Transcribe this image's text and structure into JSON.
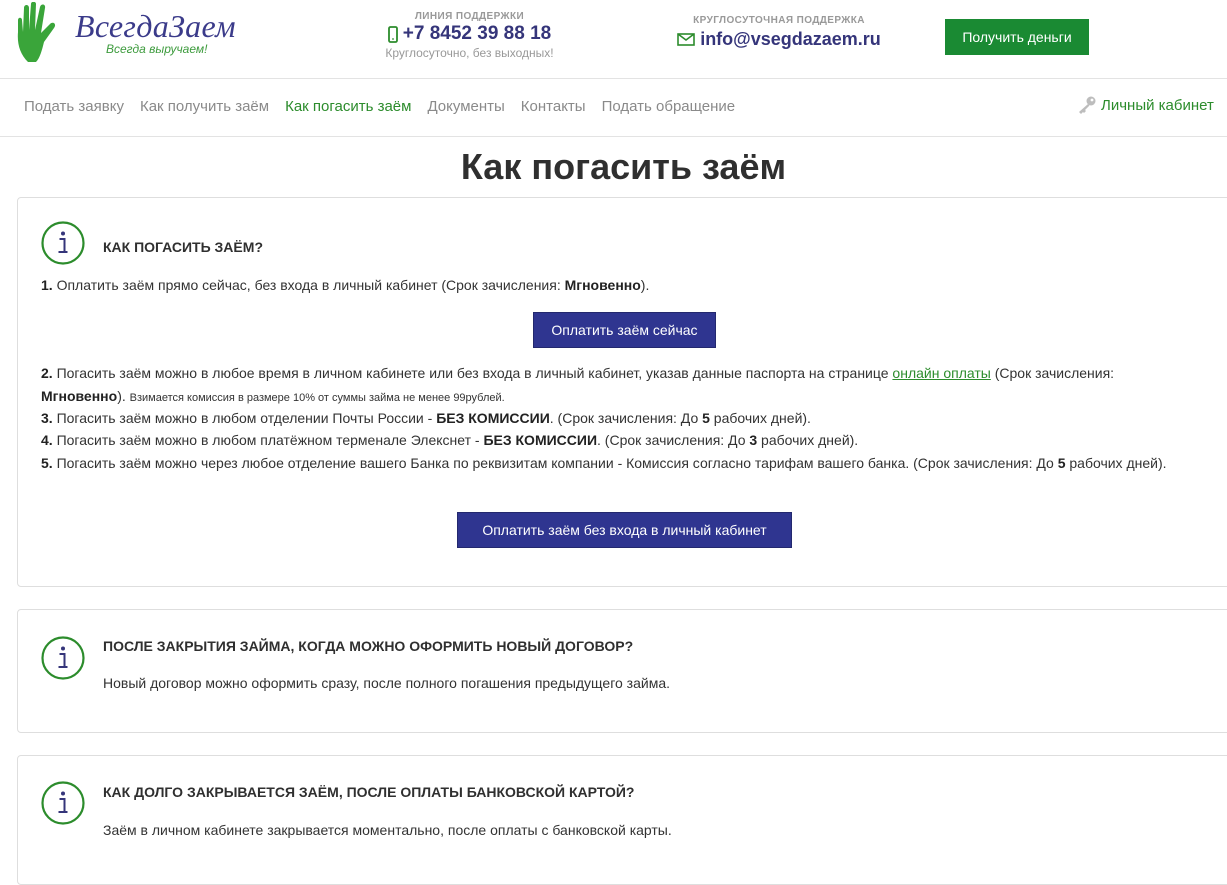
{
  "header": {
    "logo": {
      "name": "ВсегдаЗаем",
      "tagline": "Всегда выручаем!"
    },
    "support_line": {
      "caption": "ЛИНИЯ ПОДДЕРЖКИ",
      "phone": "+7 8452 39 88 18",
      "note": "Круглосуточно, без выходных!"
    },
    "round_the_clock": {
      "caption": "КРУГЛОСУТОЧНАЯ ПОДДЕРЖКА",
      "email": "info@vsegdazaem.ru"
    },
    "cta_label": "Получить деньги"
  },
  "nav": {
    "items": [
      {
        "label": "Подать заявку",
        "active": false
      },
      {
        "label": "Как получить заём",
        "active": false
      },
      {
        "label": "Как погасить заём",
        "active": true
      },
      {
        "label": "Документы",
        "active": false
      },
      {
        "label": "Контакты",
        "active": false
      },
      {
        "label": "Подать обращение",
        "active": false
      }
    ],
    "cabinet_label": "Личный кабинет"
  },
  "page": {
    "title": "Как погасить заём"
  },
  "cards": [
    {
      "heading": "КАК ПОГАСИТЬ ЗАЁМ?",
      "step1": {
        "num": "1.",
        "text": "Оплатить заём прямо сейчас, без входа в личный кабинет (Срок зачисления: ",
        "bold": "Мгновенно",
        "end": ")."
      },
      "pay_now_label": "Оплатить заём сейчас",
      "step2": {
        "num": "2.",
        "text": "Погасить заём можно в любое время в личном кабинете или без входа в личный кабинет, указав данные паспорта на странице ",
        "link": "онлайн оплаты",
        "text2": " (Срок зачисления: ",
        "bold": "Мгновенно",
        "end": ").",
        "note": "Взимается комиссия в размере 10% от суммы займа не менее 99рублей."
      },
      "step3": {
        "num": "3.",
        "text": "Погасить заём можно в любом отделении Почты России - ",
        "bold": "БЕЗ КОМИССИИ",
        "text2": ". (Срок зачисления: До ",
        "days": "5",
        "end": " рабочих дней)."
      },
      "step4": {
        "num": "4.",
        "text": "Погасить заём можно в любом платёжном терменале Элекснет - ",
        "bold": "БЕЗ КОМИССИИ",
        "text2": ".  (Срок зачисления: До ",
        "days": "3",
        "end": " рабочих дней)."
      },
      "step5": {
        "num": "5.",
        "text": "Погасить заём можно через любое отделение вашего Банка по реквизитам компании - Комиссия согласно тарифам вашего банка.  (Срок зачисления: До ",
        "days": "5",
        "end": " рабочих дней)."
      },
      "pay_nologin_label": "Оплатить заём без входа в личный кабинет"
    },
    {
      "heading": "ПОСЛЕ ЗАКРЫТИЯ ЗАЙМА, КОГДА МОЖНО ОФОРМИТЬ НОВЫЙ ДОГОВОР?",
      "text": "Новый договор можно оформить сразу, после полного погашения предыдущего займа."
    },
    {
      "heading": "КАК ДОЛГО ЗАКРЫВАЕТСЯ ЗАЁМ, ПОСЛЕ ОПЛАТЫ БАНКОВСКОЙ КАРТОЙ?",
      "text": "Заём в личном кабинете закрывается моментально, после оплаты с банковской карты."
    }
  ],
  "colors": {
    "green": "#1a8a33",
    "navy": "#2f3590",
    "text": "#333333"
  },
  "icons": [
    "hand-logo-icon",
    "mobile-phone-icon",
    "envelope-icon",
    "key-icon",
    "info-icon"
  ]
}
